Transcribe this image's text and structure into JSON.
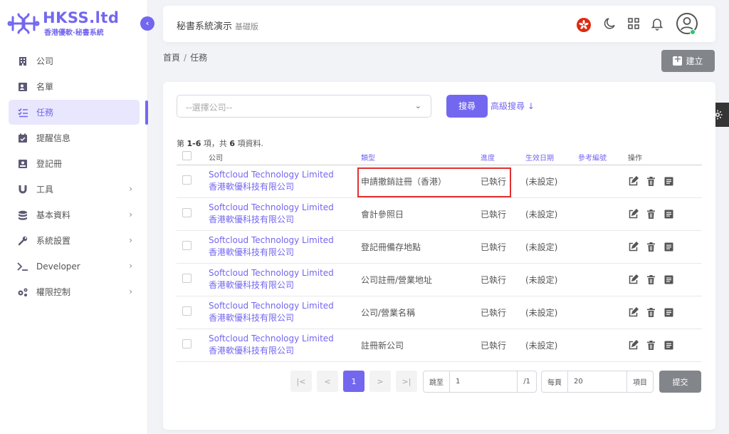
{
  "brand": {
    "title": "HKSS.ltd",
    "subtitle": "香港優軟·秘書系統"
  },
  "sidebar": {
    "items": [
      {
        "label": "公司"
      },
      {
        "label": "名單"
      },
      {
        "label": "任務"
      },
      {
        "label": "提醒信息"
      },
      {
        "label": "登記冊"
      },
      {
        "label": "工具"
      },
      {
        "label": "基本資料"
      },
      {
        "label": "系統設置"
      },
      {
        "label": "Developer"
      },
      {
        "label": "權限控制"
      }
    ]
  },
  "header": {
    "title": "秘書系統演示",
    "subtitle": "基礎版"
  },
  "breadcrumb": {
    "home": "首頁",
    "separator": "/",
    "current": "任務"
  },
  "toolbar": {
    "create_label": "建立"
  },
  "filter": {
    "company_placeholder": "--選擇公司--",
    "search_label": "搜尋",
    "advanced_label": "高級搜尋"
  },
  "summary": {
    "prefix": "第",
    "range": "1-6",
    "mid": "項，共",
    "total": "6",
    "suffix": "項資料."
  },
  "table": {
    "headers": [
      "公司",
      "類型",
      "進度",
      "生效日期",
      "參考編號",
      "操作"
    ],
    "rows": [
      {
        "company_en": "Softcloud Technology Limited",
        "company_zh": "香港軟優科技有限公司",
        "type": "申請撤銷註冊（香港）",
        "progress": "已執行",
        "date": "(未設定)"
      },
      {
        "company_en": "Softcloud Technology Limited",
        "company_zh": "香港軟優科技有限公司",
        "type": "會計參照日",
        "progress": "已執行",
        "date": "(未設定)"
      },
      {
        "company_en": "Softcloud Technology Limited",
        "company_zh": "香港軟優科技有限公司",
        "type": "登記冊備存地點",
        "progress": "已執行",
        "date": "(未設定)"
      },
      {
        "company_en": "Softcloud Technology Limited",
        "company_zh": "香港軟優科技有限公司",
        "type": "公司註冊/營業地址",
        "progress": "已執行",
        "date": "(未設定)"
      },
      {
        "company_en": "Softcloud Technology Limited",
        "company_zh": "香港軟優科技有限公司",
        "type": "公司/營業名稱",
        "progress": "已執行",
        "date": "(未設定)"
      },
      {
        "company_en": "Softcloud Technology Limited",
        "company_zh": "香港軟優科技有限公司",
        "type": "註冊新公司",
        "progress": "已執行",
        "date": "(未設定)"
      }
    ]
  },
  "pagination": {
    "first": "|<",
    "prev": "<",
    "current": "1",
    "next": ">",
    "last": ">|",
    "jump_label": "跳至",
    "jump_value": "1",
    "jump_total": "/1",
    "per_page_label": "每頁",
    "per_page_value": "20",
    "per_page_suffix": "項目",
    "submit_label": "提交"
  },
  "colors": {
    "accent": "#7367f0",
    "highlight": "#e03030",
    "button_gray": "#82868b"
  }
}
